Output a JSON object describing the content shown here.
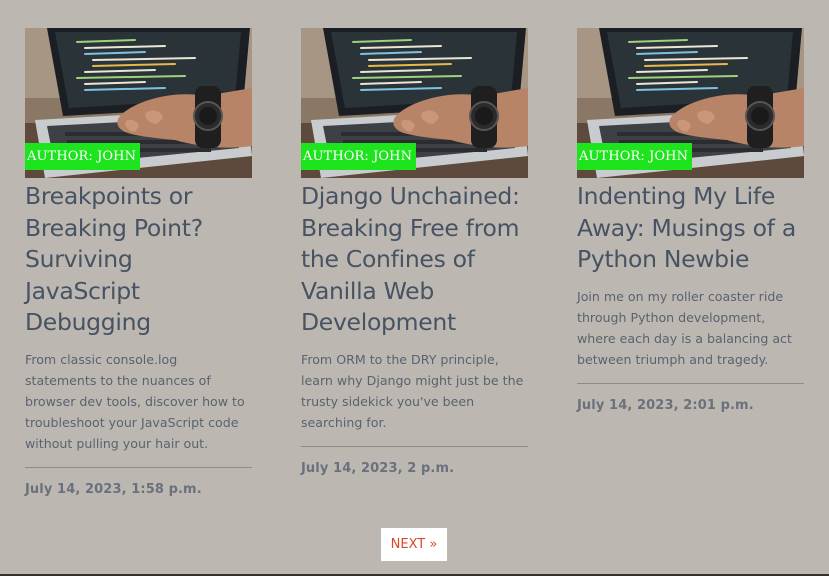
{
  "posts": [
    {
      "author": "AUTHOR: JOHN",
      "title": "Breakpoints or Breaking Point? Surviving JavaScript Debugging",
      "excerpt": "From classic console.log statements to the nuances of browser dev tools, discover how to troubleshoot your JavaScript code without pulling your hair out.",
      "date": "July 14, 2023, 1:58 p.m."
    },
    {
      "author": "AUTHOR: JOHN",
      "title": "Django Unchained: Breaking Free from the Confines of Vanilla Web Development",
      "excerpt": "From ORM to the DRY principle, learn why Django might just be the trusty sidekick you've been searching for.",
      "date": "July 14, 2023, 2 p.m."
    },
    {
      "author": "AUTHOR: JOHN",
      "title": "Indenting My Life Away: Musings of a Python Newbie",
      "excerpt": "Join me on my roller coaster ride through Python development, where each day is a balancing act between triumph and tragedy.",
      "date": "July 14, 2023, 2:01 p.m."
    }
  ],
  "pagination": {
    "next_label": "NEXT »"
  },
  "colors": {
    "background": "#bcb8b1",
    "author_badge": "#1de41d",
    "title_text": "#475263",
    "next_link": "#d9482b"
  },
  "icons": {
    "thumbnail": "laptop-typing-photo"
  }
}
